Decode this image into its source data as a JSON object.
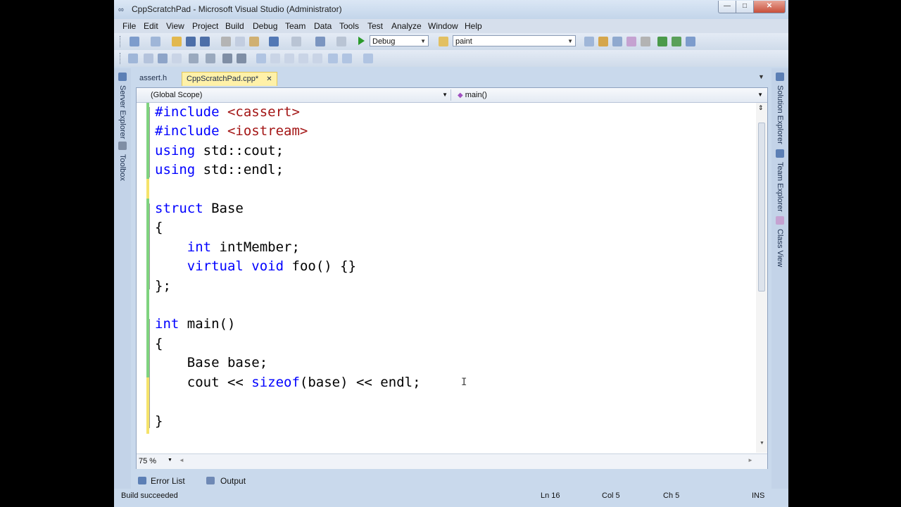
{
  "window": {
    "title": "CppScratchPad - Microsoft Visual Studio (Administrator)",
    "min_glyph": "—",
    "max_glyph": "□",
    "close_glyph": "✕"
  },
  "menu": [
    "File",
    "Edit",
    "View",
    "Project",
    "Build",
    "Debug",
    "Team",
    "Data",
    "Tools",
    "Test",
    "Analyze",
    "Window",
    "Help"
  ],
  "toolbar": {
    "config": "Debug",
    "find_text": "paint"
  },
  "side_left": {
    "server_explorer": "Server Explorer",
    "toolbox": "Toolbox"
  },
  "side_right": {
    "solution_explorer": "Solution Explorer",
    "team_explorer": "Team Explorer",
    "class_view": "Class View"
  },
  "tabs": {
    "inactive": "assert.h",
    "active": "CppScratchPad.cpp*",
    "close_glyph": "✕"
  },
  "nav": {
    "scope": "(Global Scope)",
    "member": "main()"
  },
  "code": {
    "l1a": "#include ",
    "l1b": "<cassert>",
    "l2a": "#include ",
    "l2b": "<iostream>",
    "l3a": "using",
    "l3b": " std::cout;",
    "l4a": "using",
    "l4b": " std::endl;",
    "l6a": "struct",
    "l6b": " Base",
    "l7": "{",
    "l8a": "    int",
    "l8b": " intMember;",
    "l9a": "    virtual",
    "l9b": " ",
    "l9c": "void",
    "l9d": " foo() {}",
    "l10": "};",
    "l12a": "int",
    "l12b": " main()",
    "l13": "{",
    "l14": "    Base base;",
    "l15a": "    cout << ",
    "l15b": "sizeof",
    "l15c": "(base) << endl;",
    "l17": "}"
  },
  "zoom": "75 %",
  "bottom_tabs": {
    "errors": "Error List",
    "output": "Output"
  },
  "status": {
    "message": "Build succeeded",
    "ln": "Ln 16",
    "col": "Col 5",
    "ch": "Ch 5",
    "mode": "INS"
  },
  "colors": {
    "keyword": "#0000ff",
    "string": "#a31515",
    "active_tab": "#fff1a8",
    "saved_marker": "#7fd37f",
    "unsaved_marker": "#f5e36a"
  }
}
